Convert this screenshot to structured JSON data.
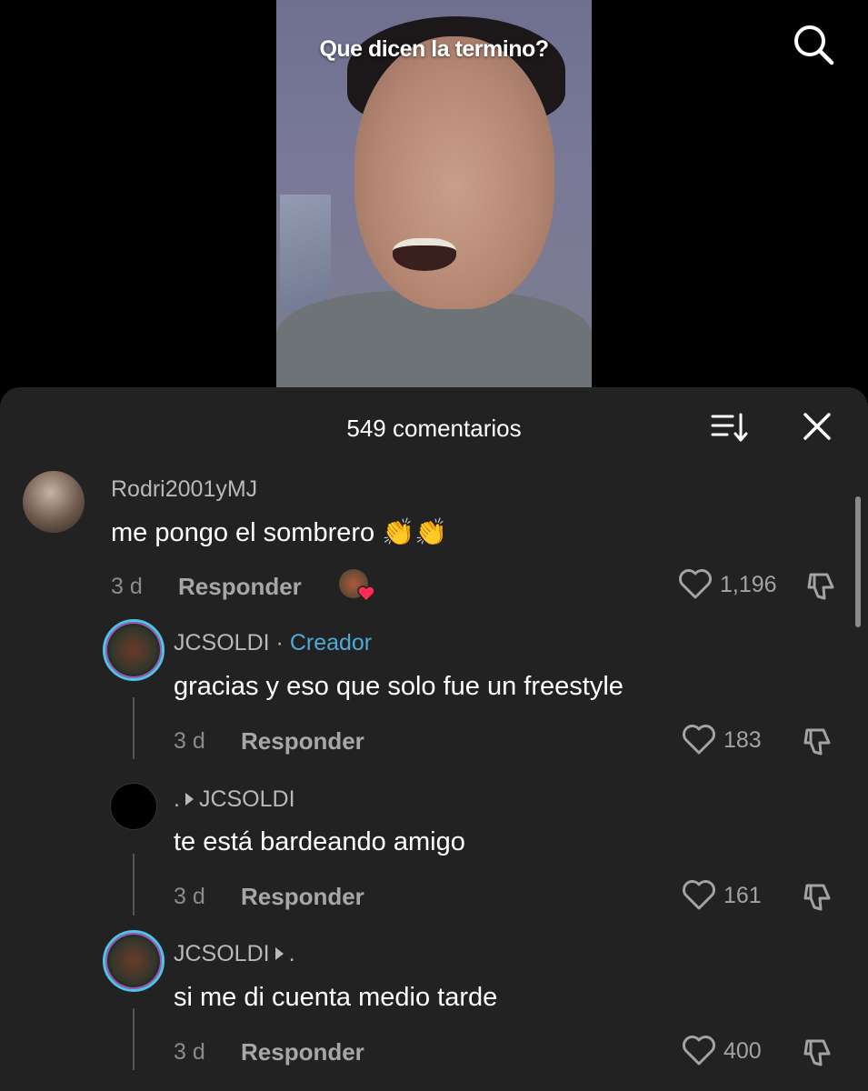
{
  "video": {
    "caption": "Que dicen la termino?"
  },
  "header": {
    "icons": {
      "search": "search-icon"
    }
  },
  "comments_sheet": {
    "title": "549 comentarios",
    "icons": {
      "sort": "sort-icon",
      "close": "close-icon"
    },
    "comments": [
      {
        "username": "Rodri2001yMJ",
        "text": "me pongo el sombrero 👏👏",
        "time": "3 d",
        "reply_label": "Responder",
        "likes": "1,196",
        "creator_liked": true
      },
      {
        "username": "JCSOLDI",
        "badge_separator": " · ",
        "badge": "Creador",
        "text": "gracias y eso que solo fue un freestyle",
        "time": "3 d",
        "reply_label": "Responder",
        "likes": "183"
      },
      {
        "username": ".",
        "reply_to": "JCSOLDI",
        "text": "te está bardeando amigo",
        "time": "3 d",
        "reply_label": "Responder",
        "likes": "161"
      },
      {
        "username": "JCSOLDI",
        "reply_to": ".",
        "text": "si me di cuenta medio tarde",
        "time": "3 d",
        "reply_label": "Responder",
        "likes": "400"
      }
    ]
  },
  "colors": {
    "sheet_bg": "#222222",
    "creator_badge": "#4fa8d6",
    "heart_red": "#fe2c55"
  }
}
